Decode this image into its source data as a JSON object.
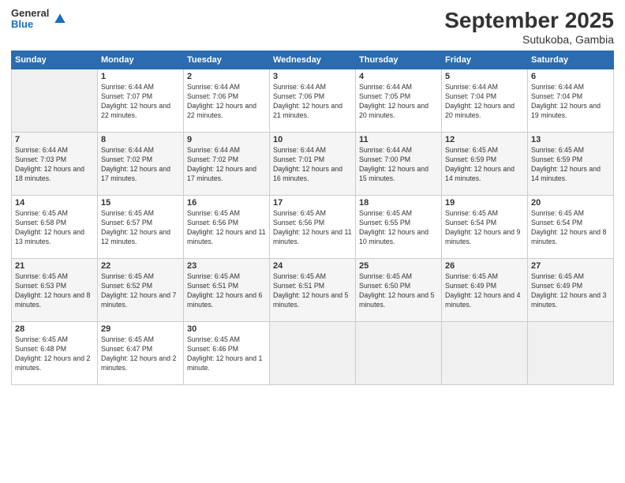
{
  "header": {
    "logo": {
      "line1": "General",
      "line2": "Blue"
    },
    "title": "September 2025",
    "subtitle": "Sutukoba, Gambia"
  },
  "days_of_week": [
    "Sunday",
    "Monday",
    "Tuesday",
    "Wednesday",
    "Thursday",
    "Friday",
    "Saturday"
  ],
  "weeks": [
    [
      {
        "day": "",
        "empty": true
      },
      {
        "day": "1",
        "sunrise": "Sunrise: 6:44 AM",
        "sunset": "Sunset: 7:07 PM",
        "daylight": "Daylight: 12 hours and 22 minutes."
      },
      {
        "day": "2",
        "sunrise": "Sunrise: 6:44 AM",
        "sunset": "Sunset: 7:06 PM",
        "daylight": "Daylight: 12 hours and 22 minutes."
      },
      {
        "day": "3",
        "sunrise": "Sunrise: 6:44 AM",
        "sunset": "Sunset: 7:06 PM",
        "daylight": "Daylight: 12 hours and 21 minutes."
      },
      {
        "day": "4",
        "sunrise": "Sunrise: 6:44 AM",
        "sunset": "Sunset: 7:05 PM",
        "daylight": "Daylight: 12 hours and 20 minutes."
      },
      {
        "day": "5",
        "sunrise": "Sunrise: 6:44 AM",
        "sunset": "Sunset: 7:04 PM",
        "daylight": "Daylight: 12 hours and 20 minutes."
      },
      {
        "day": "6",
        "sunrise": "Sunrise: 6:44 AM",
        "sunset": "Sunset: 7:04 PM",
        "daylight": "Daylight: 12 hours and 19 minutes."
      }
    ],
    [
      {
        "day": "7",
        "sunrise": "Sunrise: 6:44 AM",
        "sunset": "Sunset: 7:03 PM",
        "daylight": "Daylight: 12 hours and 18 minutes."
      },
      {
        "day": "8",
        "sunrise": "Sunrise: 6:44 AM",
        "sunset": "Sunset: 7:02 PM",
        "daylight": "Daylight: 12 hours and 17 minutes."
      },
      {
        "day": "9",
        "sunrise": "Sunrise: 6:44 AM",
        "sunset": "Sunset: 7:02 PM",
        "daylight": "Daylight: 12 hours and 17 minutes."
      },
      {
        "day": "10",
        "sunrise": "Sunrise: 6:44 AM",
        "sunset": "Sunset: 7:01 PM",
        "daylight": "Daylight: 12 hours and 16 minutes."
      },
      {
        "day": "11",
        "sunrise": "Sunrise: 6:44 AM",
        "sunset": "Sunset: 7:00 PM",
        "daylight": "Daylight: 12 hours and 15 minutes."
      },
      {
        "day": "12",
        "sunrise": "Sunrise: 6:45 AM",
        "sunset": "Sunset: 6:59 PM",
        "daylight": "Daylight: 12 hours and 14 minutes."
      },
      {
        "day": "13",
        "sunrise": "Sunrise: 6:45 AM",
        "sunset": "Sunset: 6:59 PM",
        "daylight": "Daylight: 12 hours and 14 minutes."
      }
    ],
    [
      {
        "day": "14",
        "sunrise": "Sunrise: 6:45 AM",
        "sunset": "Sunset: 6:58 PM",
        "daylight": "Daylight: 12 hours and 13 minutes."
      },
      {
        "day": "15",
        "sunrise": "Sunrise: 6:45 AM",
        "sunset": "Sunset: 6:57 PM",
        "daylight": "Daylight: 12 hours and 12 minutes."
      },
      {
        "day": "16",
        "sunrise": "Sunrise: 6:45 AM",
        "sunset": "Sunset: 6:56 PM",
        "daylight": "Daylight: 12 hours and 11 minutes."
      },
      {
        "day": "17",
        "sunrise": "Sunrise: 6:45 AM",
        "sunset": "Sunset: 6:56 PM",
        "daylight": "Daylight: 12 hours and 11 minutes."
      },
      {
        "day": "18",
        "sunrise": "Sunrise: 6:45 AM",
        "sunset": "Sunset: 6:55 PM",
        "daylight": "Daylight: 12 hours and 10 minutes."
      },
      {
        "day": "19",
        "sunrise": "Sunrise: 6:45 AM",
        "sunset": "Sunset: 6:54 PM",
        "daylight": "Daylight: 12 hours and 9 minutes."
      },
      {
        "day": "20",
        "sunrise": "Sunrise: 6:45 AM",
        "sunset": "Sunset: 6:54 PM",
        "daylight": "Daylight: 12 hours and 8 minutes."
      }
    ],
    [
      {
        "day": "21",
        "sunrise": "Sunrise: 6:45 AM",
        "sunset": "Sunset: 6:53 PM",
        "daylight": "Daylight: 12 hours and 8 minutes."
      },
      {
        "day": "22",
        "sunrise": "Sunrise: 6:45 AM",
        "sunset": "Sunset: 6:52 PM",
        "daylight": "Daylight: 12 hours and 7 minutes."
      },
      {
        "day": "23",
        "sunrise": "Sunrise: 6:45 AM",
        "sunset": "Sunset: 6:51 PM",
        "daylight": "Daylight: 12 hours and 6 minutes."
      },
      {
        "day": "24",
        "sunrise": "Sunrise: 6:45 AM",
        "sunset": "Sunset: 6:51 PM",
        "daylight": "Daylight: 12 hours and 5 minutes."
      },
      {
        "day": "25",
        "sunrise": "Sunrise: 6:45 AM",
        "sunset": "Sunset: 6:50 PM",
        "daylight": "Daylight: 12 hours and 5 minutes."
      },
      {
        "day": "26",
        "sunrise": "Sunrise: 6:45 AM",
        "sunset": "Sunset: 6:49 PM",
        "daylight": "Daylight: 12 hours and 4 minutes."
      },
      {
        "day": "27",
        "sunrise": "Sunrise: 6:45 AM",
        "sunset": "Sunset: 6:49 PM",
        "daylight": "Daylight: 12 hours and 3 minutes."
      }
    ],
    [
      {
        "day": "28",
        "sunrise": "Sunrise: 6:45 AM",
        "sunset": "Sunset: 6:48 PM",
        "daylight": "Daylight: 12 hours and 2 minutes."
      },
      {
        "day": "29",
        "sunrise": "Sunrise: 6:45 AM",
        "sunset": "Sunset: 6:47 PM",
        "daylight": "Daylight: 12 hours and 2 minutes."
      },
      {
        "day": "30",
        "sunrise": "Sunrise: 6:45 AM",
        "sunset": "Sunset: 6:46 PM",
        "daylight": "Daylight: 12 hours and 1 minute."
      },
      {
        "day": "",
        "empty": true
      },
      {
        "day": "",
        "empty": true
      },
      {
        "day": "",
        "empty": true
      },
      {
        "day": "",
        "empty": true
      }
    ]
  ]
}
